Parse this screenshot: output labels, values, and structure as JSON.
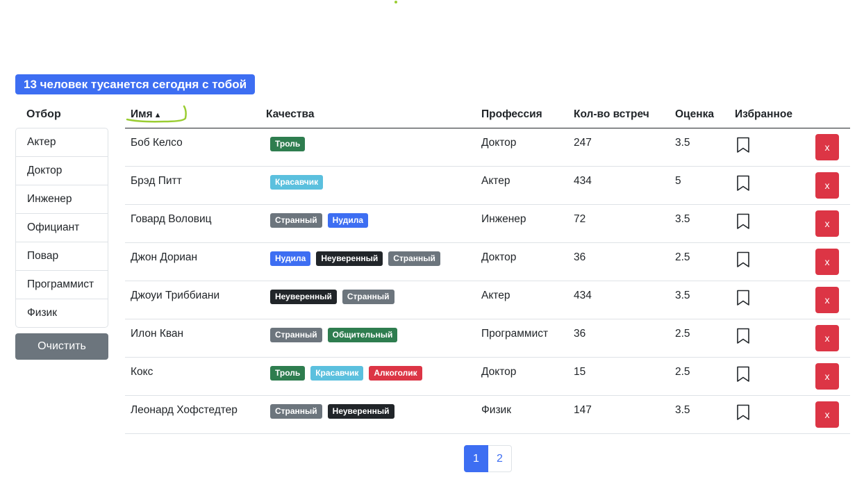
{
  "headline": "13 человек тусанется сегодня с тобой",
  "filter": {
    "title": "Отбор",
    "items": [
      "Актер",
      "Доктор",
      "Инженер",
      "Официант",
      "Повар",
      "Программист",
      "Физик"
    ],
    "clear_label": "Очистить"
  },
  "table": {
    "headers": {
      "name": "Имя",
      "sort_indicator": "▲",
      "qualities": "Качества",
      "profession": "Профессия",
      "meetings": "Кол-во встреч",
      "rating": "Оценка",
      "favorite": "Избранное"
    },
    "rows": [
      {
        "name": "Боб Келсо",
        "qualities": [
          {
            "label": "Троль",
            "color": "#2e7d4f"
          }
        ],
        "profession": "Доктор",
        "meetings": "247",
        "rating": "3.5",
        "delete_label": "x"
      },
      {
        "name": "Брэд Питт",
        "qualities": [
          {
            "label": "Красавчик",
            "color": "#5bc0de"
          }
        ],
        "profession": "Актер",
        "meetings": "434",
        "rating": "5",
        "delete_label": "x"
      },
      {
        "name": "Говард Воловиц",
        "qualities": [
          {
            "label": "Странный",
            "color": "#6c757d"
          },
          {
            "label": "Нудила",
            "color": "#3d6ef2"
          }
        ],
        "profession": "Инженер",
        "meetings": "72",
        "rating": "3.5",
        "delete_label": "x"
      },
      {
        "name": "Джон Дориан",
        "qualities": [
          {
            "label": "Нудила",
            "color": "#3d6ef2"
          },
          {
            "label": "Неуверенный",
            "color": "#212529"
          },
          {
            "label": "Странный",
            "color": "#6c757d"
          }
        ],
        "profession": "Доктор",
        "meetings": "36",
        "rating": "2.5",
        "delete_label": "x"
      },
      {
        "name": "Джоуи Триббиани",
        "qualities": [
          {
            "label": "Неуверенный",
            "color": "#212529"
          },
          {
            "label": "Странный",
            "color": "#6c757d"
          }
        ],
        "profession": "Актер",
        "meetings": "434",
        "rating": "3.5",
        "delete_label": "x"
      },
      {
        "name": "Илон Кван",
        "qualities": [
          {
            "label": "Странный",
            "color": "#6c757d"
          },
          {
            "label": "Общительный",
            "color": "#2e7d4f"
          }
        ],
        "profession": "Программист",
        "meetings": "36",
        "rating": "2.5",
        "delete_label": "x"
      },
      {
        "name": "Кокс",
        "qualities": [
          {
            "label": "Троль",
            "color": "#2e7d4f"
          },
          {
            "label": "Красавчик",
            "color": "#5bc0de"
          },
          {
            "label": "Алкоголик",
            "color": "#dc3545"
          }
        ],
        "profession": "Доктор",
        "meetings": "15",
        "rating": "2.5",
        "delete_label": "x"
      },
      {
        "name": "Леонард Хофстедтер",
        "qualities": [
          {
            "label": "Странный",
            "color": "#6c757d"
          },
          {
            "label": "Неуверенный",
            "color": "#212529"
          }
        ],
        "profession": "Физик",
        "meetings": "147",
        "rating": "3.5",
        "delete_label": "x"
      }
    ]
  },
  "pagination": {
    "pages": [
      "1",
      "2"
    ],
    "current": "1"
  },
  "icons": {
    "favorite": "bookmark-icon"
  }
}
